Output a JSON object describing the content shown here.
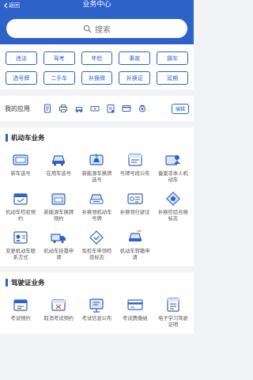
{
  "nav": {
    "back_label": "返回",
    "title": "业务中心"
  },
  "search": {
    "placeholder": "搜索"
  },
  "tags": [
    "违法",
    "驾考",
    "年检",
    "事故",
    "挪车",
    "选号牌",
    "二手车",
    "补换牌",
    "补换证",
    "延期"
  ],
  "my_apps": {
    "label": "我的应用",
    "edit_label": "编辑",
    "icons": [
      "document-icon",
      "printer-icon",
      "car-icon",
      "car-plate-icon",
      "clipboard-icon",
      "card-icon",
      "camera-icon"
    ]
  },
  "vehicle": {
    "title": "机动车业务",
    "items": [
      {
        "label": "新车选号",
        "icon": "car-plate-icon"
      },
      {
        "label": "在用车选号",
        "icon": "car-front-icon"
      },
      {
        "label": "新能源车换牌选号",
        "icon": "ev-car-icon"
      },
      {
        "label": "号牌号段公布",
        "icon": "plate-list-icon"
      },
      {
        "label": "备案非本人机动车",
        "icon": "person-car-icon"
      },
      {
        "label": "机动车检验预约",
        "icon": "inspect-calendar-icon"
      },
      {
        "label": "新能源车换牌预约",
        "icon": "ev-calendar-icon"
      },
      {
        "label": "补换领机动车号牌",
        "icon": "plate-renew-icon"
      },
      {
        "label": "补换领行驶证",
        "icon": "license-card-icon"
      },
      {
        "label": "补换检验合格标志",
        "icon": "badge-icon"
      },
      {
        "label": "变更机动车联系方式",
        "icon": "contact-edit-icon"
      },
      {
        "label": "机动车挂靠申请",
        "icon": "truck-icon"
      },
      {
        "label": "免检车申领检验标志",
        "icon": "exempt-badge-icon"
      },
      {
        "label": "机动车转籍申请",
        "icon": "transfer-icon"
      }
    ]
  },
  "driver": {
    "title": "驾驶证业务",
    "items": [
      {
        "label": "考试预约",
        "icon": "exam-calendar-icon"
      },
      {
        "label": "取消考试预约",
        "icon": "cancel-calendar-icon"
      },
      {
        "label": "考试信息公布",
        "icon": "info-board-icon"
      },
      {
        "label": "考试费缴纳",
        "icon": "payment-card-icon"
      },
      {
        "label": "电子学习驾驶证明",
        "icon": "e-document-icon"
      }
    ]
  },
  "colors": {
    "primary": "#2d63c8",
    "background": "#f2f3f7"
  }
}
